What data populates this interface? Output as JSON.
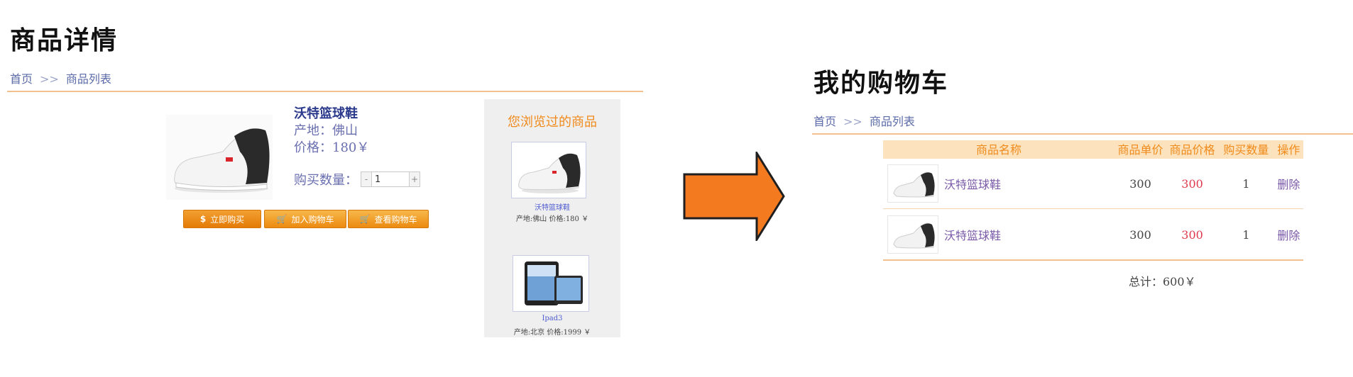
{
  "left": {
    "title": "商品详情",
    "breadcrumb": {
      "home": "首页",
      "separator": ">>",
      "list": "商品列表"
    },
    "product": {
      "name": "沃特篮球鞋",
      "origin": "产地：佛山",
      "price": "价格：180￥",
      "qty_label": "购买数量：",
      "qty_value": "1",
      "qty_minus": "-",
      "qty_plus": "+"
    },
    "buttons": {
      "buy_now": "立即购买",
      "add_cart": "加入购物车",
      "view_cart": "查看购物车"
    },
    "history": {
      "title": "您浏览过的商品",
      "items": [
        {
          "caption": "沃特篮球鞋",
          "meta": "产地:佛山   价格:180 ￥"
        },
        {
          "caption": "Ipad3",
          "meta": "产地:北京   价格:1999 ￥"
        }
      ]
    }
  },
  "right": {
    "title": "我的购物车",
    "breadcrumb": {
      "home": "首页",
      "separator": ">>",
      "list": "商品列表"
    },
    "table": {
      "headers": [
        "商品名称",
        "商品单价",
        "商品价格",
        "购买数量",
        "操作"
      ],
      "rows": [
        {
          "name": "沃特篮球鞋",
          "unit_price": "300",
          "price": "300",
          "qty": "1",
          "action": "删除"
        },
        {
          "name": "沃特篮球鞋",
          "unit_price": "300",
          "price": "300",
          "qty": "1",
          "action": "删除"
        }
      ]
    },
    "total": "总计：600￥"
  },
  "colors": {
    "accent_orange": "#f08a1a",
    "arrow": "#f47a20",
    "link_blue": "#5b6aa8"
  }
}
